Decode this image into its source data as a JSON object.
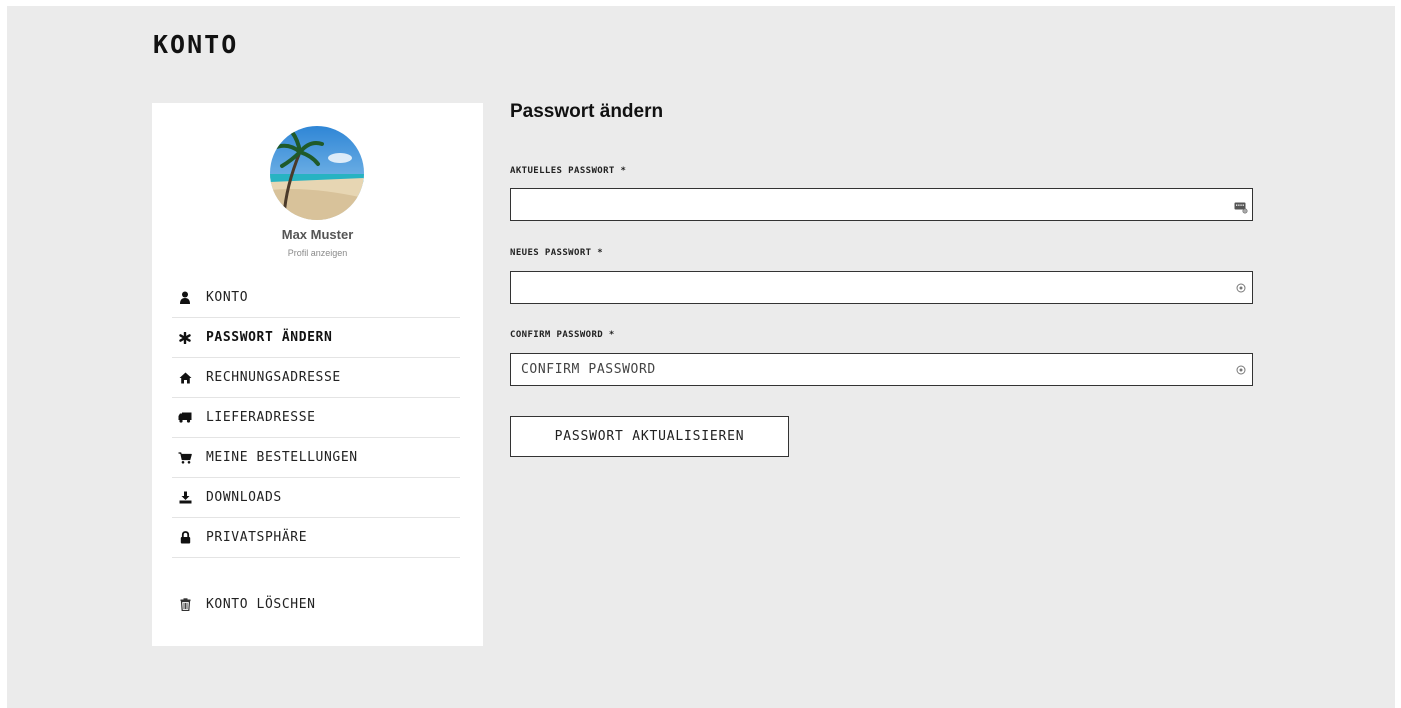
{
  "page": {
    "title": "KONTO"
  },
  "sidebar": {
    "user_name": "Max Muster",
    "profile_link": "Profil anzeigen",
    "items": [
      {
        "label": "KONTO",
        "icon": "user-icon",
        "active": false
      },
      {
        "label": "PASSWORT ÄNDERN",
        "icon": "asterisk-icon",
        "active": true
      },
      {
        "label": "RECHNUNGSADRESSE",
        "icon": "home-icon",
        "active": false
      },
      {
        "label": "LIEFERADRESSE",
        "icon": "truck-icon",
        "active": false
      },
      {
        "label": "MEINE BESTELLUNGEN",
        "icon": "cart-icon",
        "active": false
      },
      {
        "label": "DOWNLOADS",
        "icon": "download-icon",
        "active": false
      },
      {
        "label": "PRIVATSPHÄRE",
        "icon": "lock-icon",
        "active": false
      }
    ],
    "delete_account": {
      "label": "KONTO LÖSCHEN",
      "icon": "trash-icon"
    }
  },
  "form": {
    "title": "Passwort ändern",
    "fields": [
      {
        "label": "AKTUELLES PASSWORT *",
        "value": "",
        "placeholder": "",
        "icon": "password-manager-icon"
      },
      {
        "label": "NEUES PASSWORT *",
        "value": "",
        "placeholder": "",
        "icon": "eye-icon"
      },
      {
        "label": "CONFIRM PASSWORD *",
        "value": "",
        "placeholder": "CONFIRM PASSWORD",
        "icon": "eye-icon"
      }
    ],
    "submit_label": "PASSWORT AKTUALISIEREN"
  },
  "colors": {
    "page_background": "#ebebeb",
    "panel": "#ffffff",
    "text": "#111111",
    "border": "#333333"
  }
}
